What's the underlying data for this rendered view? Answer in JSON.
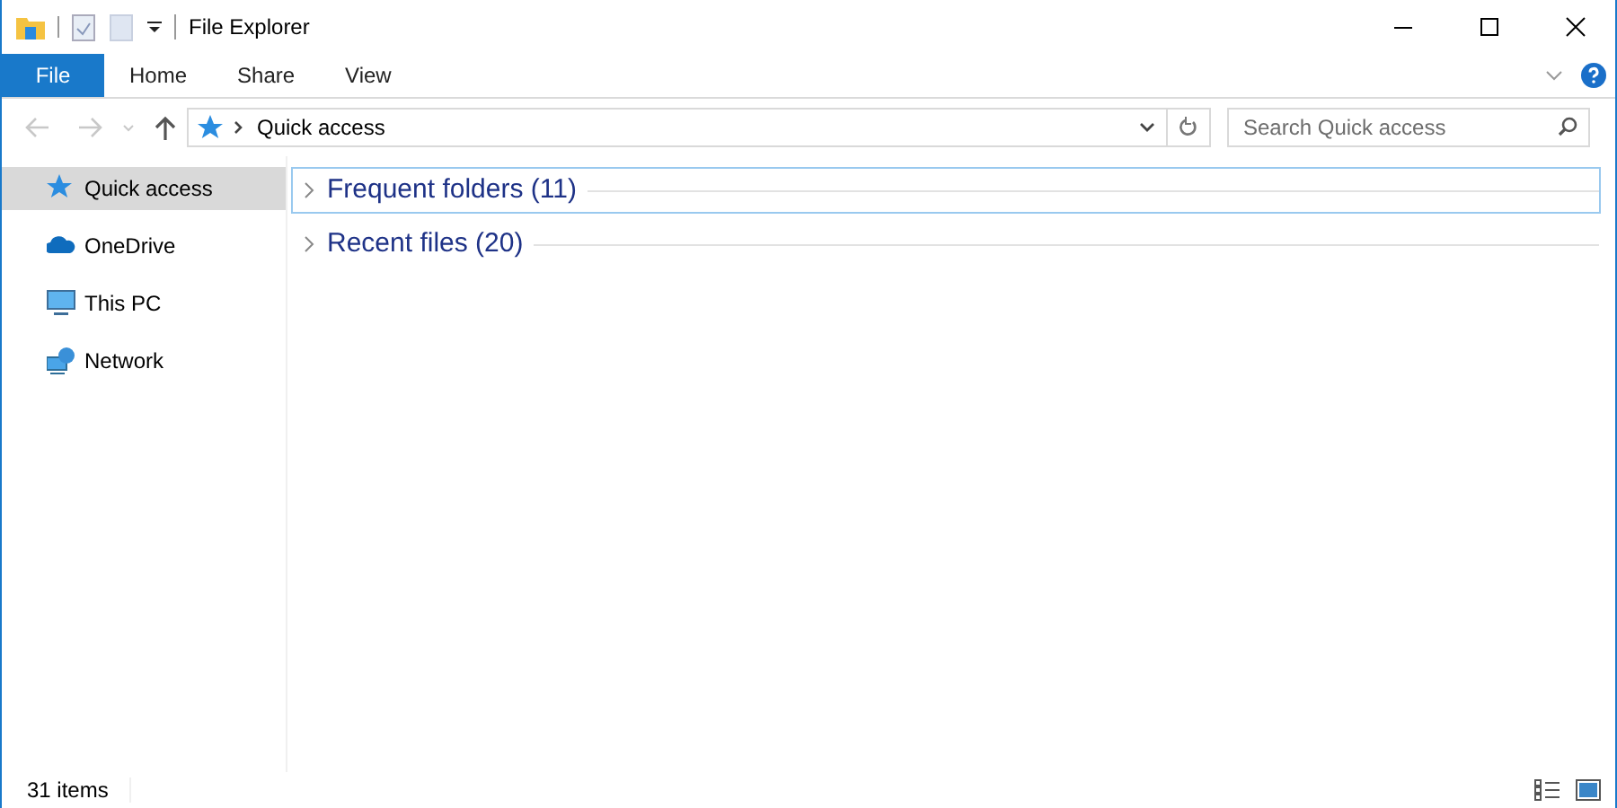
{
  "window": {
    "title": "File Explorer"
  },
  "ribbon_tabs": [
    {
      "label": "File",
      "kind": "file"
    },
    {
      "label": "Home",
      "kind": "tab"
    },
    {
      "label": "Share",
      "kind": "tab"
    },
    {
      "label": "View",
      "kind": "tab"
    }
  ],
  "address_bar": {
    "path": "Quick access"
  },
  "search": {
    "placeholder": "Search Quick access"
  },
  "sidebar": {
    "items": [
      {
        "label": "Quick access",
        "kind": "star",
        "selected": true
      },
      {
        "label": "OneDrive",
        "kind": "cloud",
        "selected": false
      },
      {
        "label": "This PC",
        "kind": "pc",
        "selected": false
      },
      {
        "label": "Network",
        "kind": "network",
        "selected": false
      }
    ]
  },
  "groups": [
    {
      "label": "Frequent folders (11)",
      "focused": true
    },
    {
      "label": "Recent files (20)",
      "focused": false
    }
  ],
  "status_bar": {
    "text": "31 items"
  }
}
